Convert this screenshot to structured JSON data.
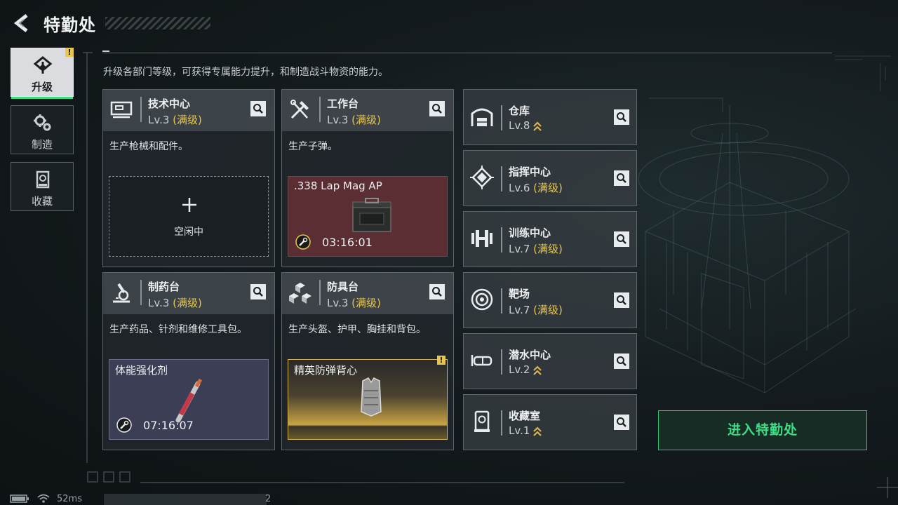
{
  "header": {
    "title": "特勤处"
  },
  "nav": {
    "tabs": [
      {
        "label": "升级",
        "active": true,
        "alert": "!"
      },
      {
        "label": "制造",
        "active": false
      },
      {
        "label": "收藏",
        "active": false
      }
    ]
  },
  "description": "升级各部门等级，可获得专属能力提升，和制造战斗物资的能力。",
  "level_max_tag": "(满级)",
  "facilities_main": [
    {
      "name": "技术中心",
      "level": "Lv.3",
      "maxed": true,
      "desc": "生产枪械和配件。",
      "slot": {
        "state": "idle",
        "idle_text": "空闲中"
      }
    },
    {
      "name": "工作台",
      "level": "Lv.3",
      "maxed": true,
      "desc": "生产子弹。",
      "slot": {
        "state": "producing",
        "item": ".338 Lap Mag AP",
        "timer": "03:16:01",
        "color": "#5a2e33"
      }
    },
    {
      "name": "制药台",
      "level": "Lv.3",
      "maxed": true,
      "desc": "生产药品、针剂和维修工具包。",
      "slot": {
        "state": "producing",
        "item": "体能强化剂",
        "timer": "07:16:07",
        "color": "#3b3e55"
      }
    },
    {
      "name": "防具台",
      "level": "Lv.3",
      "maxed": true,
      "desc": "生产头盔、护甲、胸挂和背包。",
      "slot": {
        "state": "done",
        "item": "精英防弹背心",
        "alert": "!",
        "color": "#c9a443"
      }
    }
  ],
  "facilities_side": [
    {
      "name": "仓库",
      "level": "Lv.8",
      "maxed": false,
      "upgradable": true
    },
    {
      "name": "指挥中心",
      "level": "Lv.6",
      "maxed": true
    },
    {
      "name": "训练中心",
      "level": "Lv.7",
      "maxed": true
    },
    {
      "name": "靶场",
      "level": "Lv.7",
      "maxed": true
    },
    {
      "name": "潜水中心",
      "level": "Lv.2",
      "maxed": false,
      "upgradable": true
    },
    {
      "name": "收藏室",
      "level": "Lv.1",
      "maxed": false,
      "upgradable": true
    }
  ],
  "enter_button": "进入特勤处",
  "status": {
    "ping": "52ms",
    "extra": "2"
  },
  "colors": {
    "accent_green": "#3ddc84",
    "max_level_gold": "#e8c64a",
    "upgrade_chevron": "#d9b552"
  }
}
